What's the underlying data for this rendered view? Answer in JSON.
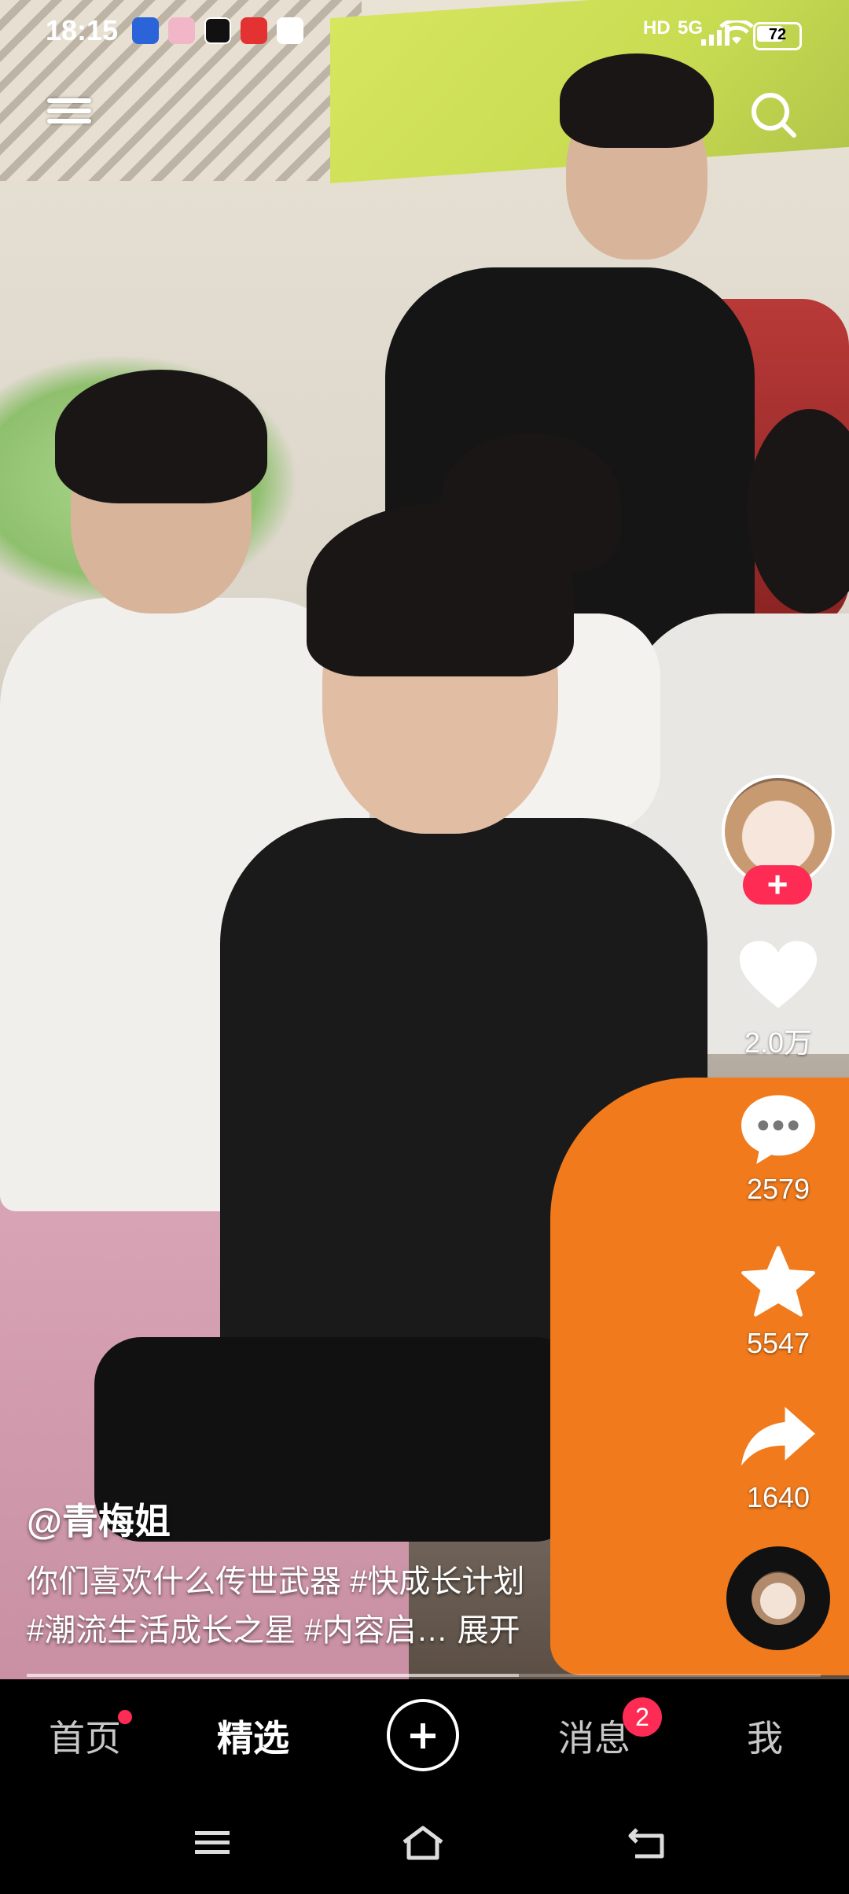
{
  "status_bar": {
    "time": "18:15",
    "network": "5G",
    "hd": "HD",
    "battery": "72",
    "battery_level": 0.72
  },
  "top": {
    "menu_icon": "hamburger-menu-icon",
    "search_icon": "search-icon"
  },
  "rail": {
    "follow_label": "+",
    "likes": "2.0万",
    "comments": "2579",
    "favorites": "5547",
    "shares": "1640"
  },
  "caption": {
    "author": "@青梅姐",
    "line1": "你们喜欢什么传世武器 #快成长计划",
    "line2": "#潮流生活成长之星 #内容启…",
    "expand": "展开"
  },
  "playback": {
    "progress": 0.62
  },
  "nav": {
    "home": "首页",
    "featured": "精选",
    "messages": "消息",
    "messages_badge": "2",
    "me": "我"
  },
  "colors": {
    "accent": "#fe2c55",
    "background": "#000000",
    "text": "#ffffff"
  }
}
